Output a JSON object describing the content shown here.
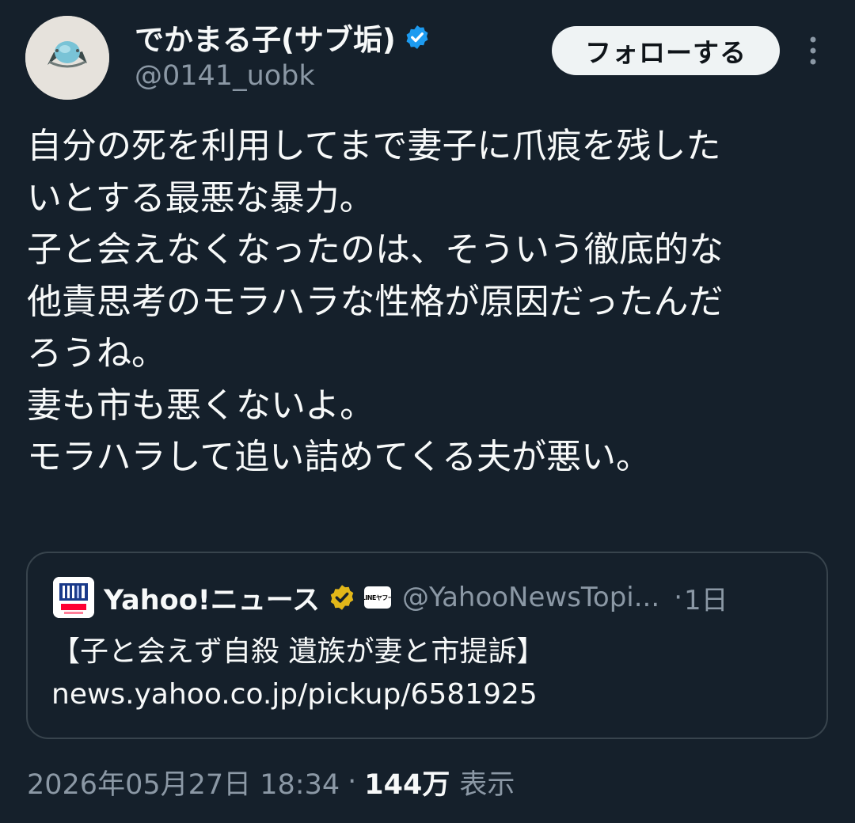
{
  "author": {
    "display_name": "でかまる子(サブ垢)",
    "handle": "@0141_uobk",
    "avatar_icon": "ring-photo-avatar",
    "verified_color": "#1d9bf0"
  },
  "actions": {
    "follow_label": "フォローする",
    "more_icon": "more-vertical-icon"
  },
  "tweet": {
    "lines": [
      "自分の死を利用してまで妻子に爪痕を残した",
      "いとする最悪な暴力。",
      "子と会えなくなったのは、そういう徹底的な",
      "他責思考のモラハラな性格が原因だったんだ",
      "ろうね。",
      "妻も市も悪くないよ。",
      "モラハラして追い詰めてくる夫が悪い。"
    ]
  },
  "quote": {
    "display_name": "Yahoo!ニュース",
    "badge_color": "#e2b719",
    "affiliate_badge": "LINEヤフー",
    "handle": "@YahooNewsTopi...",
    "separator": "·",
    "time": "1日",
    "text": "【子と会えず自殺 遺族が妻と市提訴】",
    "link": "news.yahoo.co.jp/pickup/6581925"
  },
  "meta": {
    "timestamp": "2026年05月27日 18:34",
    "separator": "·",
    "views_count": "144万",
    "views_label": "表示"
  }
}
